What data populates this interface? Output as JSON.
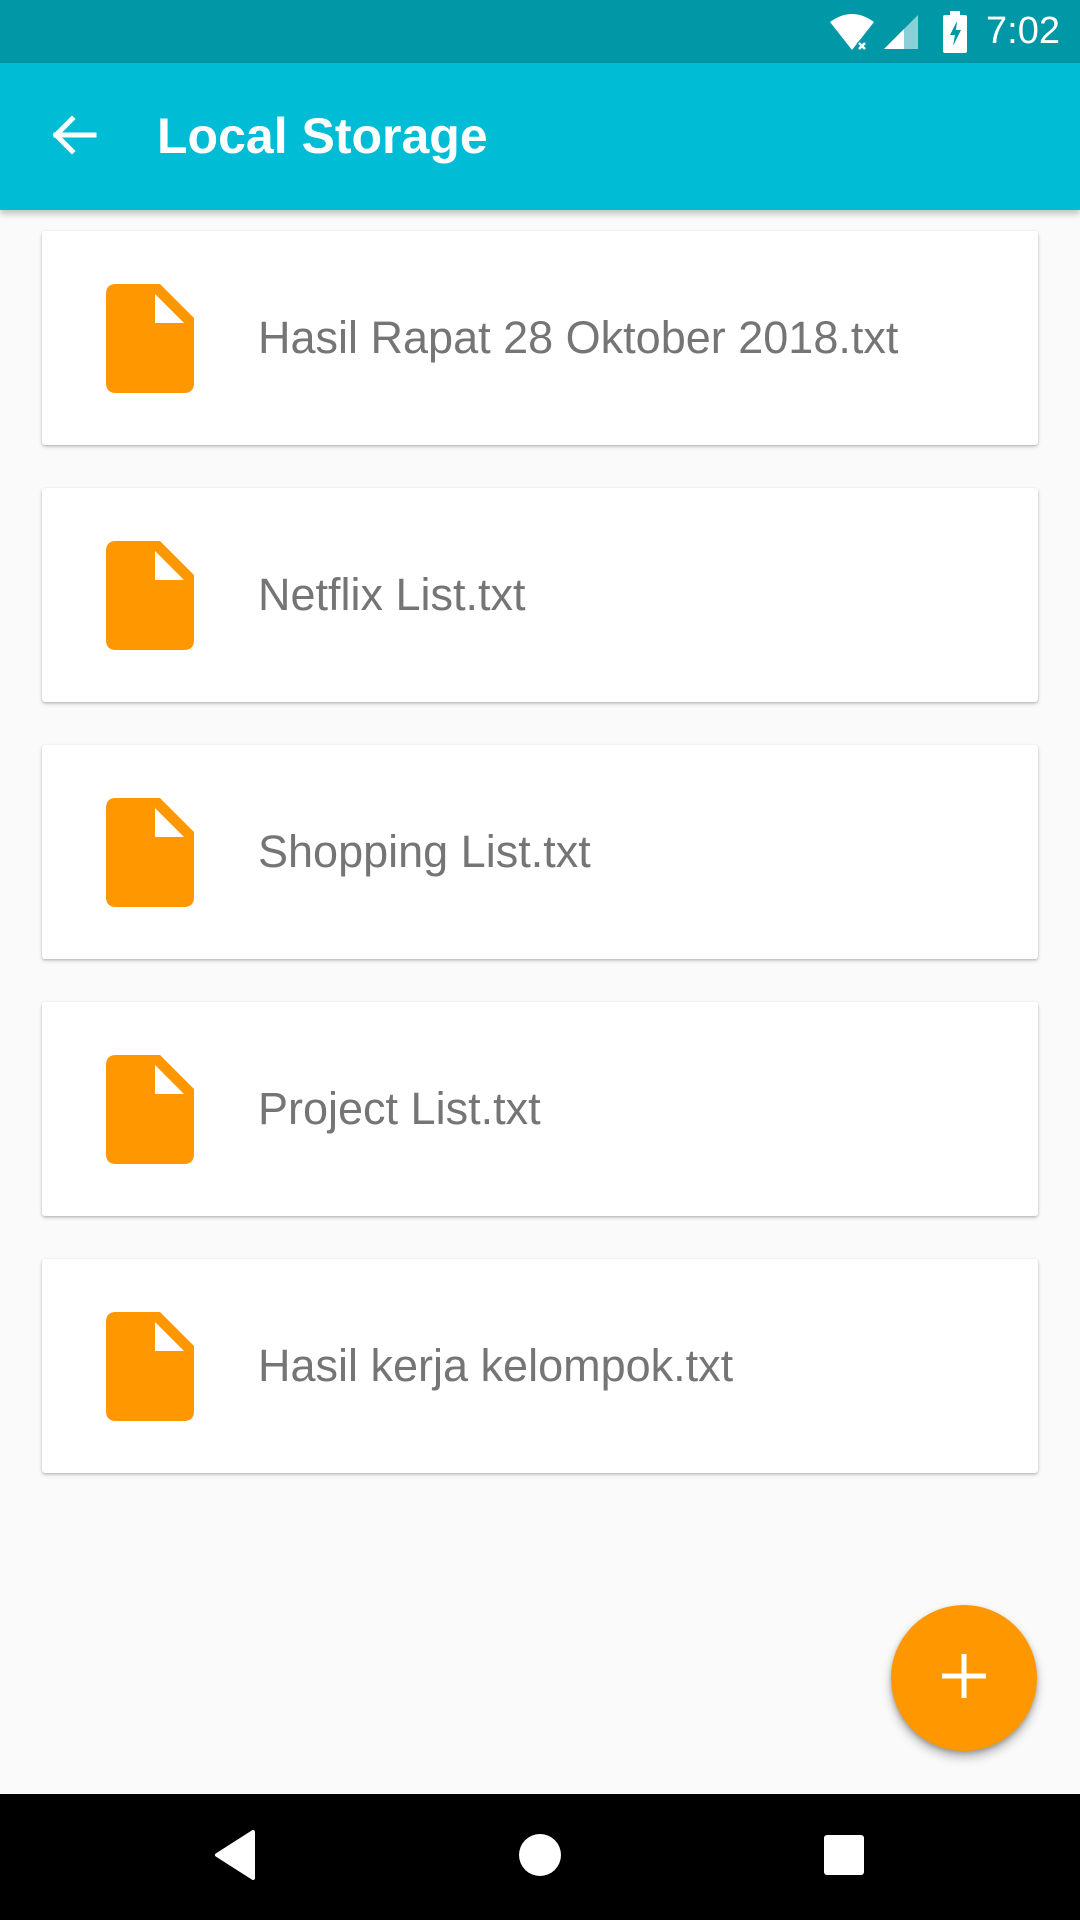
{
  "status_bar": {
    "time": "7:02",
    "icons": [
      "wifi-icon",
      "signal-icon",
      "battery-icon"
    ]
  },
  "app_bar": {
    "title": "Local Storage",
    "back_icon": "arrow-back-icon"
  },
  "files": [
    {
      "name": "Hasil Rapat 28 Oktober 2018.txt",
      "icon": "file-icon"
    },
    {
      "name": "Netflix List.txt",
      "icon": "file-icon"
    },
    {
      "name": "Shopping List.txt",
      "icon": "file-icon"
    },
    {
      "name": "Project List.txt",
      "icon": "file-icon"
    },
    {
      "name": "Hasil kerja kelompok.txt",
      "icon": "file-icon"
    }
  ],
  "fab": {
    "icon": "plus-icon"
  },
  "nav_bar": {
    "icons": [
      "back-triangle-icon",
      "home-circle-icon",
      "recents-square-icon"
    ]
  },
  "colors": {
    "status_bar": "#0097a7",
    "app_bar": "#00bcd4",
    "accent": "#ff9800",
    "file_text": "#757575",
    "background": "#fafafa"
  }
}
